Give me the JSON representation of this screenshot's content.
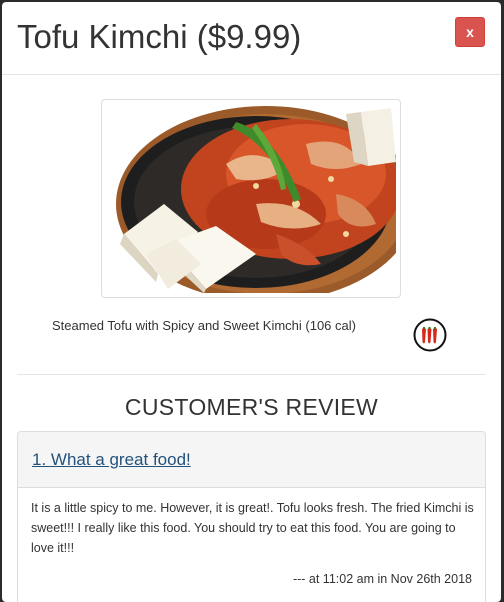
{
  "modal": {
    "title": "Tofu Kimchi ($9.99)",
    "close_label": "x"
  },
  "item": {
    "image_alt": "Tofu Kimchi",
    "description": "Steamed Tofu with Spicy and Sweet Kimchi (106 cal)",
    "spicy_icon": "chili-peppers-icon"
  },
  "reviews": {
    "section_title": "CUSTOMER'S REVIEW",
    "items": [
      {
        "title": "1. What a great food!",
        "body": "It is a little spicy to me. However, it is great!. Tofu looks fresh. The fried Kimchi is sweet!!! I really like this food. You should try to eat this food. You are going to love it!!!",
        "meta": "--- at 11:02 am in Nov 26th 2018"
      }
    ]
  },
  "colors": {
    "close_button": "#d9534f",
    "link": "#23527c",
    "panel_heading": "#f5f5f5"
  }
}
